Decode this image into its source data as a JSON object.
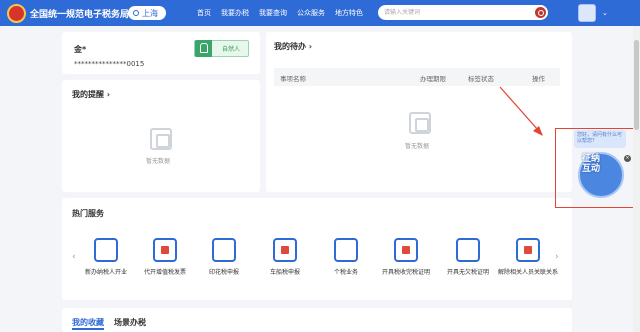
{
  "header": {
    "site_title": "全国统一规范电子税务局",
    "region": "上海",
    "nav": [
      "首页",
      "我要办税",
      "我要查询",
      "公众服务",
      "地方特色"
    ],
    "search_placeholder": "请输入关键词"
  },
  "user": {
    "name": "金*",
    "id_masked": "***************0015",
    "role_button": "自然人"
  },
  "reminders": {
    "title": "我的提醒 ›",
    "empty": "暂无数据"
  },
  "todo": {
    "title": "我的待办 ›",
    "columns": [
      "事项名称",
      "办理期限",
      "标签状态",
      "操作"
    ],
    "empty": "暂无数据"
  },
  "hot_services": {
    "title": "热门服务",
    "items": [
      {
        "label": "新办纳税人开业",
        "icon": "shop-icon"
      },
      {
        "label": "代开增值税发票",
        "icon": "invoice-icon"
      },
      {
        "label": "印花税申报",
        "icon": "stamp-icon"
      },
      {
        "label": "车船税申报",
        "icon": "car-icon"
      },
      {
        "label": "个税业务",
        "icon": "tax-doc-icon"
      },
      {
        "label": "开具税收完税证明",
        "icon": "printer-icon"
      },
      {
        "label": "开具无欠税证明",
        "icon": "certificate-icon"
      },
      {
        "label": "解除相关人员关联关系",
        "icon": "unlink-icon"
      }
    ]
  },
  "bottom_tabs": [
    "我的收藏",
    "场景办税"
  ],
  "assistant": {
    "bubble_text": "您好，请问有什么可以帮您？",
    "mascot_text": "征纳互动"
  },
  "colors": {
    "brand": "#2f6bd6",
    "accent_red": "#e44434",
    "green": "#3aa46a"
  }
}
